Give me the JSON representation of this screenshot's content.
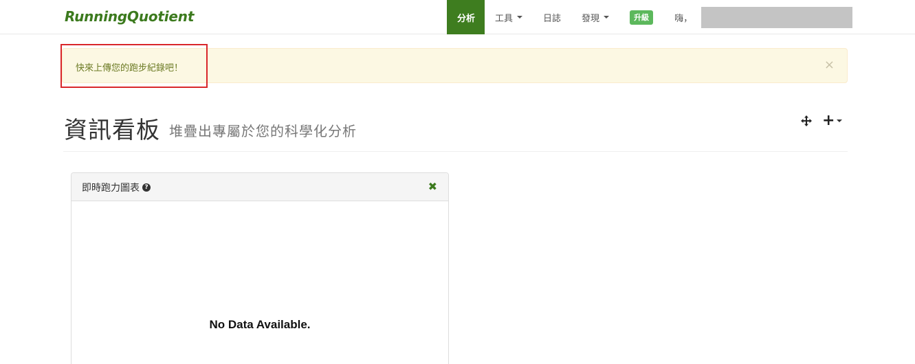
{
  "brand": "RunningQuotient",
  "nav": {
    "analysis": "分析",
    "tools": "工具",
    "journal": "日誌",
    "discover": "發現",
    "upgrade": "升級",
    "greeting": "嗨，"
  },
  "alert": {
    "message": "快來上傳您的跑步紀錄吧！",
    "close": "×"
  },
  "header": {
    "title": "資訊看板",
    "subtitle": "堆疊出專屬於您的科學化分析",
    "add": "+"
  },
  "panel": {
    "title": "即時跑力圖表",
    "help": "?",
    "close": "✖",
    "empty_message": "No Data Available."
  },
  "colors": {
    "brand_green": "#3c7a1e",
    "nav_active_bg": "#3e7d1f",
    "upgrade_badge": "#5cb85c",
    "alert_bg": "#fcf8e3",
    "highlight_border": "#d9262a"
  }
}
